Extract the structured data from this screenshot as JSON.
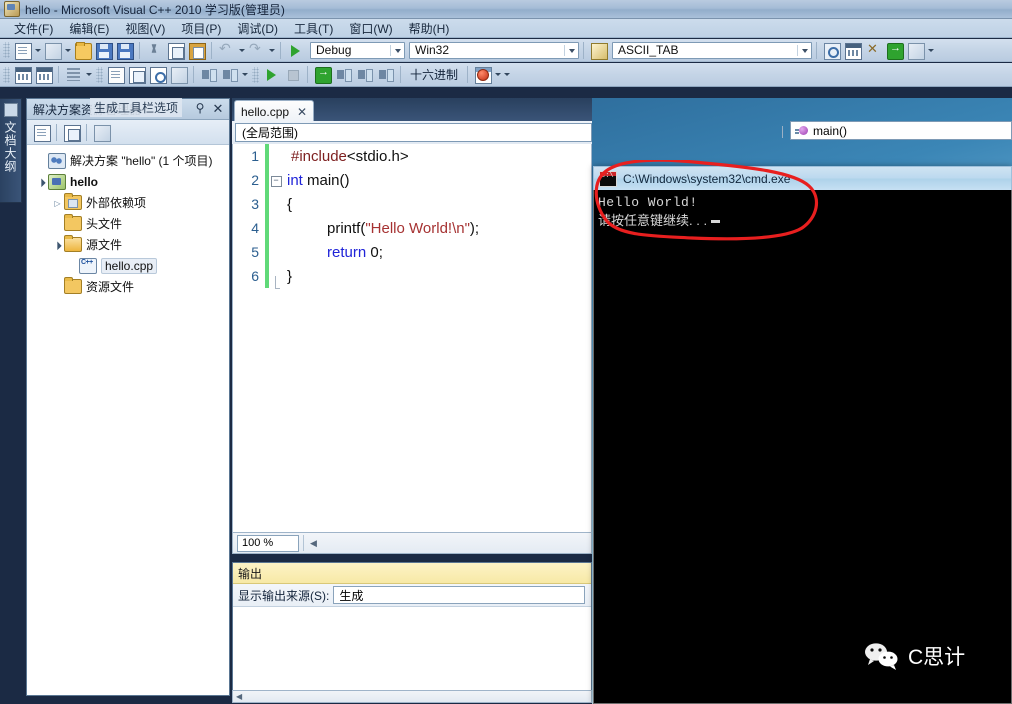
{
  "window": {
    "title": "hello - Microsoft Visual C++ 2010 学习版(管理员)",
    "icon": "visual-studio-icon"
  },
  "menubar": {
    "items": [
      {
        "label": "文件(F)"
      },
      {
        "label": "编辑(E)"
      },
      {
        "label": "视图(V)"
      },
      {
        "label": "项目(P)"
      },
      {
        "label": "调试(D)"
      },
      {
        "label": "工具(T)"
      },
      {
        "label": "窗口(W)"
      },
      {
        "label": "帮助(H)"
      }
    ]
  },
  "toolbar": {
    "config_combo": "Debug",
    "platform_combo": "Win32",
    "symbol_combo": "ASCII_TAB",
    "hex_label": "十六进制"
  },
  "outline_tab": {
    "label": "文档大纲"
  },
  "solution_explorer": {
    "title": "解决方案资源管理器",
    "tooltip": "生成工具栏选项",
    "pin": "⚲",
    "close": "✕",
    "tree": [
      {
        "label": "解决方案 \"hello\" (1 个项目)",
        "icon": "solution-icon",
        "depth": 0,
        "expander": "none",
        "bold": false,
        "selected": false
      },
      {
        "label": "hello",
        "icon": "project-icon",
        "depth": 1,
        "expander": "open",
        "bold": true,
        "selected": false
      },
      {
        "label": "外部依赖项",
        "icon": "dependencies-folder-icon",
        "depth": 2,
        "expander": "closed",
        "bold": false,
        "selected": false
      },
      {
        "label": "头文件",
        "icon": "folder-icon",
        "depth": 2,
        "expander": "none",
        "bold": false,
        "selected": false
      },
      {
        "label": "源文件",
        "icon": "folder-open-icon",
        "depth": 2,
        "expander": "open",
        "bold": false,
        "selected": false
      },
      {
        "label": "hello.cpp",
        "icon": "cpp-file-icon",
        "depth": 3,
        "expander": "none",
        "bold": false,
        "selected": true
      },
      {
        "label": "资源文件",
        "icon": "folder-icon",
        "depth": 2,
        "expander": "none",
        "bold": false,
        "selected": false
      }
    ]
  },
  "editor": {
    "tab_label": "hello.cpp",
    "tab_close": "✕",
    "scope_combo": "(全局范围)",
    "member_combo": "main()",
    "zoom_level": "100 %",
    "lines": [
      {
        "num": "1",
        "fold": "none",
        "tokens": [
          {
            "t": "#include",
            "c": "k-pre"
          },
          {
            "t": "<stdio.h>",
            "c": "k-plain"
          }
        ],
        "indent": 8
      },
      {
        "num": "2",
        "fold": "box",
        "tokens": [
          {
            "t": "int",
            "c": "k-kw"
          },
          {
            "t": " main()",
            "c": "k-plain"
          }
        ],
        "indent": 0
      },
      {
        "num": "3",
        "fold": "line",
        "tokens": [
          {
            "t": "{",
            "c": "k-plain"
          }
        ],
        "indent": 0
      },
      {
        "num": "4",
        "fold": "line",
        "tokens": [
          {
            "t": "printf(",
            "c": "k-plain"
          },
          {
            "t": "\"Hello World!\\n\"",
            "c": "k-str"
          },
          {
            "t": ");",
            "c": "k-plain"
          }
        ],
        "indent": 44
      },
      {
        "num": "5",
        "fold": "line",
        "tokens": [
          {
            "t": "return",
            "c": "k-kw"
          },
          {
            "t": " 0;",
            "c": "k-plain"
          }
        ],
        "indent": 44
      },
      {
        "num": "6",
        "fold": "end",
        "tokens": [
          {
            "t": "}",
            "c": "k-plain"
          }
        ],
        "indent": 0
      }
    ]
  },
  "output_pane": {
    "title": "输出",
    "source_label": "显示输出来源(S):",
    "source_value": "生成"
  },
  "console": {
    "title": "C:\\Windows\\system32\\cmd.exe",
    "icon": "cmd-icon",
    "line1": "Hello World!",
    "line2": "请按任意键继续. . ."
  },
  "annotation": {
    "shape": "hand-drawn-red-ellipse",
    "color": "#e81f1f"
  },
  "watermark": {
    "text": "C思计",
    "logo": "wechat-icon"
  },
  "colors": {
    "accent": "#3a5478",
    "titlebar": "#a5bcd6",
    "output_header": "#f7e9a6",
    "annotation_red": "#e81f1f",
    "change_bar_green": "#60d978"
  }
}
